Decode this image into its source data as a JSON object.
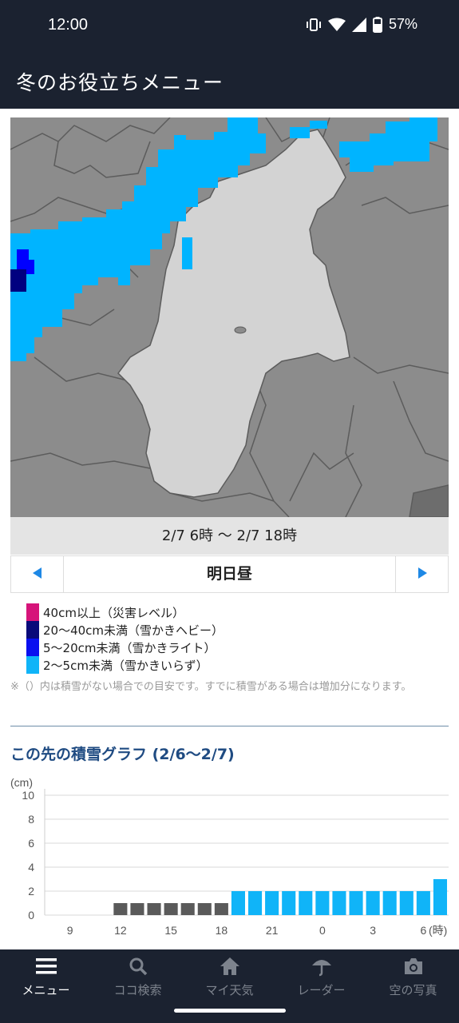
{
  "status_bar": {
    "time": "12:00",
    "battery": "57%",
    "icons": [
      "vibrate-icon",
      "wifi-icon",
      "signal-icon",
      "battery-icon"
    ]
  },
  "app_bar": {
    "title": "冬のお役立ちメニュー"
  },
  "map": {
    "colors": {
      "background": "#8c8c8c",
      "highlight_region": "#d3d3d3",
      "snow_light": "#00b4ff",
      "snow_medium": "#0000ff",
      "snow_heavy": "#000080"
    }
  },
  "forecast": {
    "period": "2/7 6時 〜 2/7 18時",
    "label": "明日昼",
    "prev_icon": "triangle-left-icon",
    "next_icon": "triangle-right-icon"
  },
  "legend": {
    "items": [
      {
        "label": "40cm以上（災害レベル）",
        "color": "#d6147a"
      },
      {
        "label": "20〜40cm未満（雪かきヘビー）",
        "color": "#0a0a7a"
      },
      {
        "label": "5〜20cm未満（雪かきライト）",
        "color": "#0a10f0"
      },
      {
        "label": "2〜5cm未満（雪かきいらず）",
        "color": "#10b4f8"
      }
    ]
  },
  "note": "※（）内は積雪がない場合での目安です。すでに積雪がある場合は増加分になります。",
  "graph": {
    "title": "この先の積雪グラフ (2/6〜2/7)"
  },
  "chart_data": {
    "type": "bar",
    "title": "この先の積雪グラフ (2/6〜2/7)",
    "ylabel": "(cm)",
    "xlabel": "(時)",
    "ylim": [
      0,
      10
    ],
    "yticks": [
      0,
      2,
      4,
      6,
      8,
      10
    ],
    "xticks": [
      "9",
      "12",
      "15",
      "18",
      "21",
      "0",
      "3",
      "6"
    ],
    "categories": [
      "8",
      "9",
      "10",
      "11",
      "12",
      "13",
      "14",
      "15",
      "16",
      "17",
      "18",
      "19",
      "20",
      "21",
      "22",
      "23",
      "0",
      "1",
      "2",
      "3",
      "4",
      "5",
      "6",
      "7"
    ],
    "values": [
      0,
      0,
      0,
      0,
      1,
      1,
      1,
      1,
      1,
      1,
      1,
      2,
      2,
      2,
      2,
      2,
      2,
      2,
      2,
      2,
      2,
      2,
      2,
      3
    ],
    "colors": {
      "past": "#5a5a5a",
      "forecast": "#10b4f8"
    },
    "forecast_start_index": 11,
    "grid": true
  },
  "bottom_nav": {
    "tabs": [
      {
        "label": "メニュー",
        "icon": "menu-icon",
        "active": true
      },
      {
        "label": "ココ検索",
        "icon": "search-icon",
        "active": false
      },
      {
        "label": "マイ天気",
        "icon": "home-icon",
        "active": false
      },
      {
        "label": "レーダー",
        "icon": "umbrella-icon",
        "active": false
      },
      {
        "label": "空の写真",
        "icon": "camera-icon",
        "active": false
      }
    ]
  }
}
